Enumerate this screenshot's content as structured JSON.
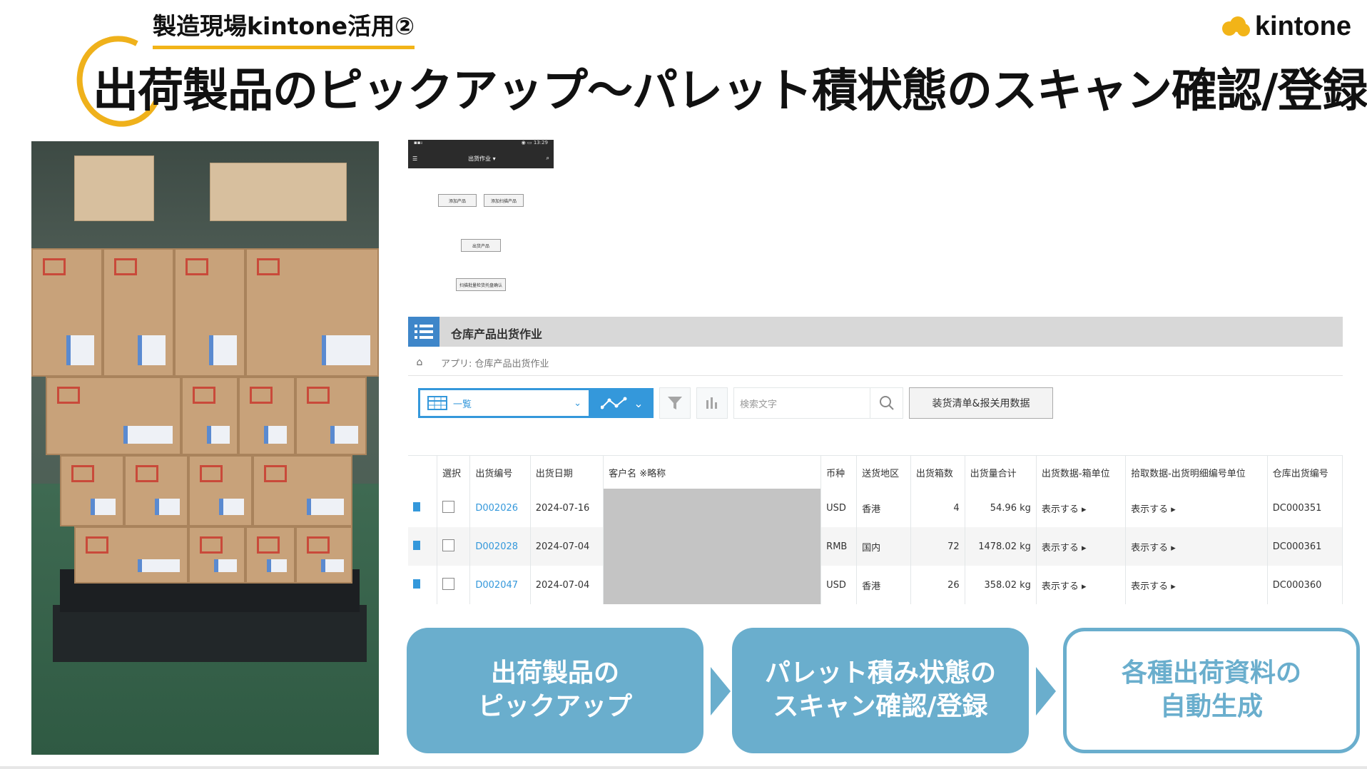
{
  "slide": {
    "subtitle": "製造現場kintone活用②",
    "title": "出荷製品のピックアップ～パレット積状態のスキャン確認/登録",
    "logo_text": "kintone",
    "logo_color": "#f2b418"
  },
  "phone": {
    "status_left": "▪▪ᵢₗ",
    "status_right": "◉ ▭ 13:29",
    "app_label": "出货作业 ▾",
    "buttons": [
      "添加产品",
      "添加扫描产品",
      "出货产品",
      "扫描批量检货托盘确认"
    ]
  },
  "app": {
    "name": "仓库产品出货作业",
    "breadcrumb": "アプリ: 仓库产品出货作业",
    "view_select": "一覧",
    "search_placeholder": "検索文字",
    "custom_button": "装货清单&报关用数据",
    "columns": [
      "選択",
      "出货编号",
      "出货日期",
      "客户名 ※略称",
      "币种",
      "送货地区",
      "出货箱数",
      "出货量合计",
      "出货数据-箱单位",
      "拾取数据-出货明细编号单位",
      "仓库出货编号"
    ],
    "rows": [
      {
        "id": "D002026",
        "date": "2024-07-16",
        "currency": "USD",
        "region": "香港",
        "boxes": "4",
        "weight": "54.96 kg",
        "box_data": "表示する ▸",
        "pick_data": "表示する ▸",
        "wh_no": "DC000351"
      },
      {
        "id": "D002028",
        "date": "2024-07-04",
        "currency": "RMB",
        "region": "国内",
        "boxes": "72",
        "weight": "1478.02 kg",
        "box_data": "表示する ▸",
        "pick_data": "表示する ▸",
        "wh_no": "DC000361"
      },
      {
        "id": "D002047",
        "date": "2024-07-04",
        "currency": "USD",
        "region": "香港",
        "boxes": "26",
        "weight": "358.02 kg",
        "box_data": "表示する ▸",
        "pick_data": "表示する ▸",
        "wh_no": "DC000360"
      }
    ]
  },
  "flow": {
    "step1_line1": "出荷製品の",
    "step1_line2": "ピックアップ",
    "step2_line1": "パレット積み状態の",
    "step2_line2": "スキャン確認/登録",
    "step3_line1": "各種出荷資料の",
    "step3_line2": "自動生成"
  },
  "colors": {
    "accent": "#6aaecd",
    "kintone_blue": "#3498db"
  }
}
